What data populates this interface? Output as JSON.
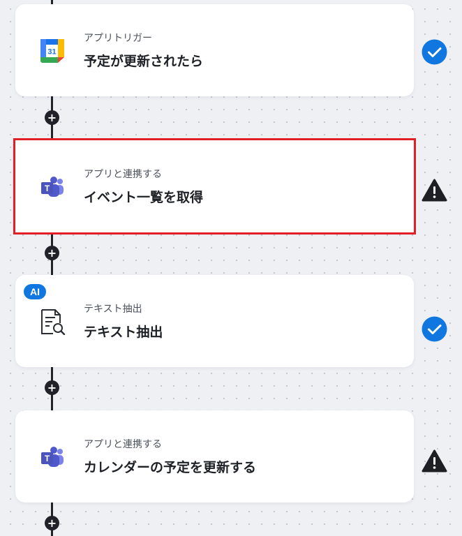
{
  "colors": {
    "accent": "#1177e0",
    "selection": "#e01f26",
    "line": "#1f2228",
    "warning": "#1d1f24"
  },
  "flow": {
    "plus_label": "+",
    "steps": [
      {
        "subtitle": "アプリトリガー",
        "title": "予定が更新されたら",
        "icon": "google-calendar-icon",
        "calendar_day": "31",
        "status": "check-circle-icon"
      },
      {
        "subtitle": "アプリと連携する",
        "title": "イベント一覧を取得",
        "icon": "microsoft-teams-icon",
        "selected": true,
        "status": "warning-icon"
      },
      {
        "subtitle": "テキスト抽出",
        "title": "テキスト抽出",
        "icon": "document-search-icon",
        "badge": "AI",
        "status": "check-circle-icon"
      },
      {
        "subtitle": "アプリと連携する",
        "title": "カレンダーの予定を更新する",
        "icon": "microsoft-teams-icon",
        "status": "warning-icon"
      }
    ]
  }
}
